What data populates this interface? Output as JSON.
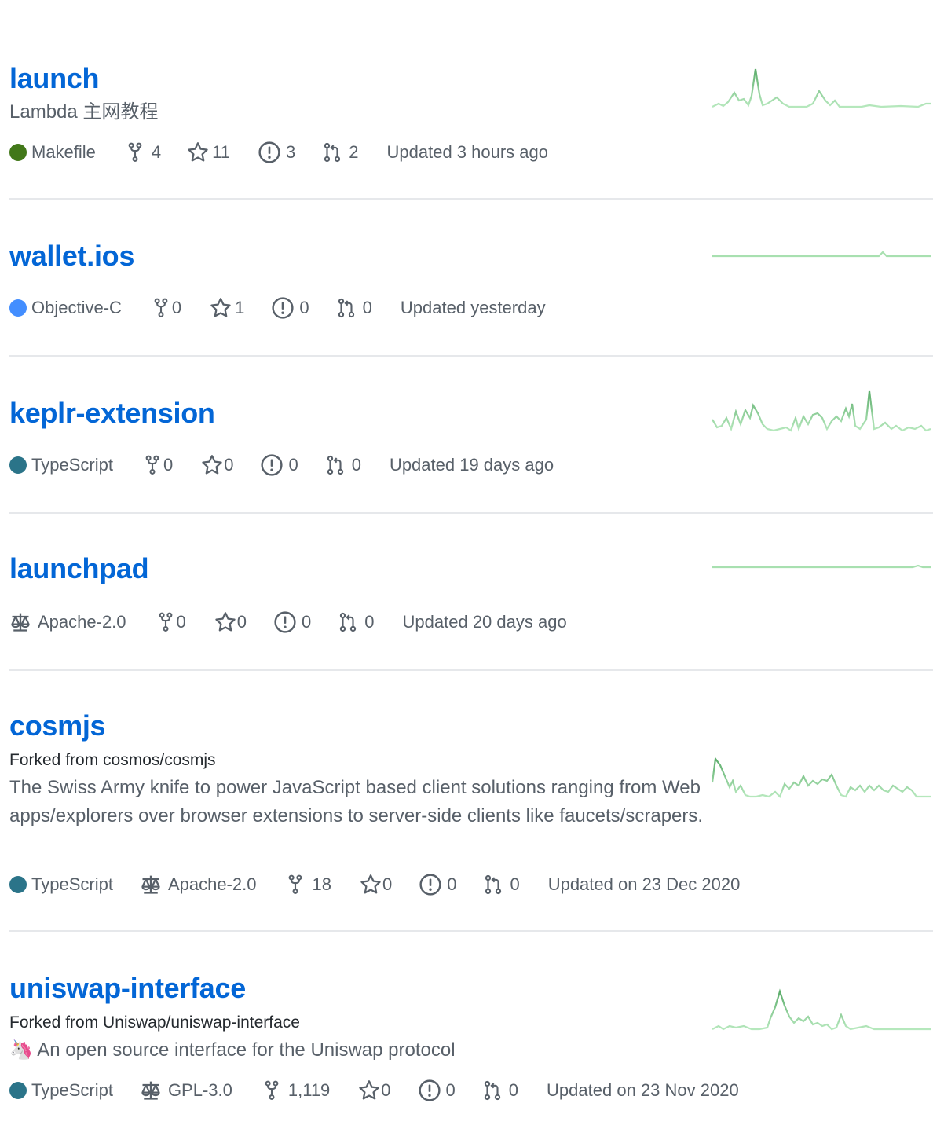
{
  "colors": {
    "link": "#0366d6",
    "muted": "#586069",
    "divider": "#e6e8eb",
    "sparkline_light": "#a8e0b0",
    "sparkline_dark": "#5cad6b"
  },
  "repos": [
    {
      "name": "launch",
      "description": "Lambda 主网教程",
      "language": "Makefile",
      "language_color": "#427819",
      "forks": "4",
      "stars": "11",
      "issues": "3",
      "prs": "2",
      "updated": "Updated 3 hours ago"
    },
    {
      "name": "wallet.ios",
      "language": "Objective-C",
      "language_color": "#438eff",
      "forks": "0",
      "stars": "1",
      "issues": "0",
      "prs": "0",
      "updated": "Updated yesterday"
    },
    {
      "name": "keplr-extension",
      "language": "TypeScript",
      "language_color": "#2b7489",
      "forks": "0",
      "stars": "0",
      "issues": "0",
      "prs": "0",
      "updated": "Updated 19 days ago"
    },
    {
      "name": "launchpad",
      "license": "Apache-2.0",
      "forks": "0",
      "stars": "0",
      "issues": "0",
      "prs": "0",
      "updated": "Updated 20 days ago"
    },
    {
      "name": "cosmjs",
      "forked_from": "Forked from cosmos/cosmjs",
      "description": "The Swiss Army knife to power JavaScript based client solutions ranging from Web apps/explorers over browser extensions to server-side clients like faucets/scrapers.",
      "language": "TypeScript",
      "language_color": "#2b7489",
      "license": "Apache-2.0",
      "forks": "18",
      "stars": "0",
      "issues": "0",
      "prs": "0",
      "updated": "Updated on 23 Dec 2020"
    },
    {
      "name": "uniswap-interface",
      "forked_from": "Forked from Uniswap/uniswap-interface",
      "description": "🦄 An open source interface for the Uniswap protocol",
      "language": "TypeScript",
      "language_color": "#2b7489",
      "license": "GPL-3.0",
      "forks": "1,119",
      "stars": "0",
      "issues": "0",
      "prs": "0",
      "updated": "Updated on 23 Nov 2020"
    }
  ]
}
